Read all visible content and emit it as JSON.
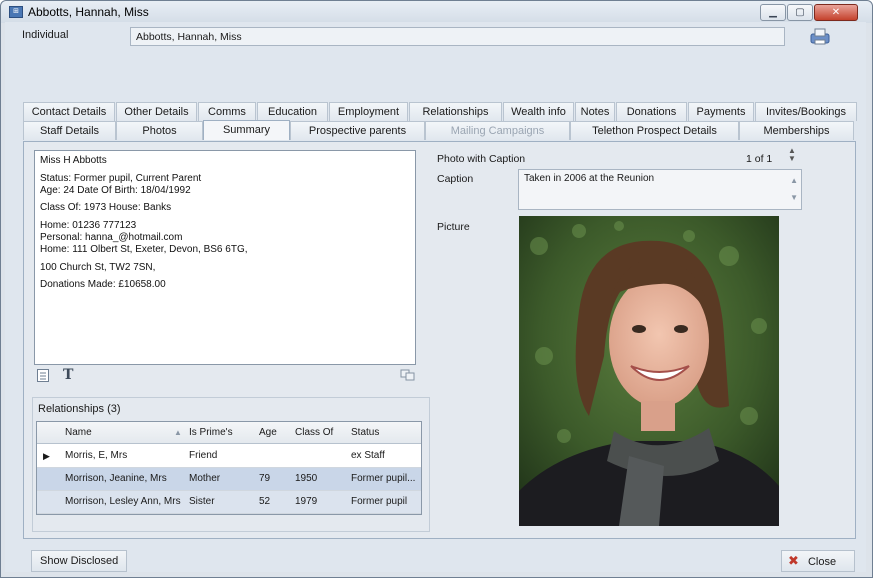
{
  "window": {
    "title": "Abbotts, Hannah, Miss",
    "app_icon": "contact-card-icon"
  },
  "header": {
    "individual_label": "Individual",
    "individual_value": "Abbotts, Hannah, Miss",
    "print_icon": "printer-icon"
  },
  "tabs_row1": [
    "Contact Details",
    "Other Details",
    "Comms",
    "Education",
    "Employment",
    "Relationships",
    "Wealth info",
    "Notes",
    "Donations",
    "Payments",
    "Invites/Bookings"
  ],
  "tabs_row2": [
    {
      "label": "Staff Details",
      "disabled": false
    },
    {
      "label": "Photos",
      "disabled": false
    },
    {
      "label": "Summary",
      "disabled": false,
      "active": true
    },
    {
      "label": "Prospective parents",
      "disabled": false
    },
    {
      "label": "Mailing Campaigns",
      "disabled": true
    },
    {
      "label": "Telethon Prospect Details",
      "disabled": false
    },
    {
      "label": "Memberships",
      "disabled": false
    }
  ],
  "summary": {
    "lines": [
      "Miss H Abbotts",
      "",
      "Status: Former pupil, Current Parent",
      "Age: 24    Date Of Birth: 18/04/1992",
      "",
      "Class Of: 1973    House: Banks",
      "",
      "Home: 01236 777123",
      "Personal: hanna_@hotmail.com",
      "Home: 111 Olbert St, Exeter, Devon, BS6 6TG,",
      "",
      "100 Church St, TW2 7SN,",
      "",
      "Donations Made: £10658.00"
    ]
  },
  "relationships": {
    "label": "Relationships  (3)",
    "columns": [
      "Name",
      "Is Prime's",
      "Age",
      "Class Of",
      "Status"
    ],
    "rows": [
      [
        "Morris, E, Mrs",
        "Friend",
        "",
        "",
        "ex Staff"
      ],
      [
        "Morrison, Jeanine, Mrs",
        "Mother",
        "79",
        "1950",
        "Former pupil..."
      ],
      [
        "Morrison, Lesley Ann, Mrs",
        "Sister",
        "52",
        "1979",
        "Former pupil"
      ]
    ]
  },
  "photo_panel": {
    "photo_caption_label": "Photo with Caption",
    "counter": "1 of 1",
    "caption_label": "Caption",
    "caption_value": "Taken in 2006 at the Reunion",
    "picture_label": "Picture"
  },
  "footer": {
    "show_disclosed": "Show Disclosed",
    "close": "Close"
  }
}
